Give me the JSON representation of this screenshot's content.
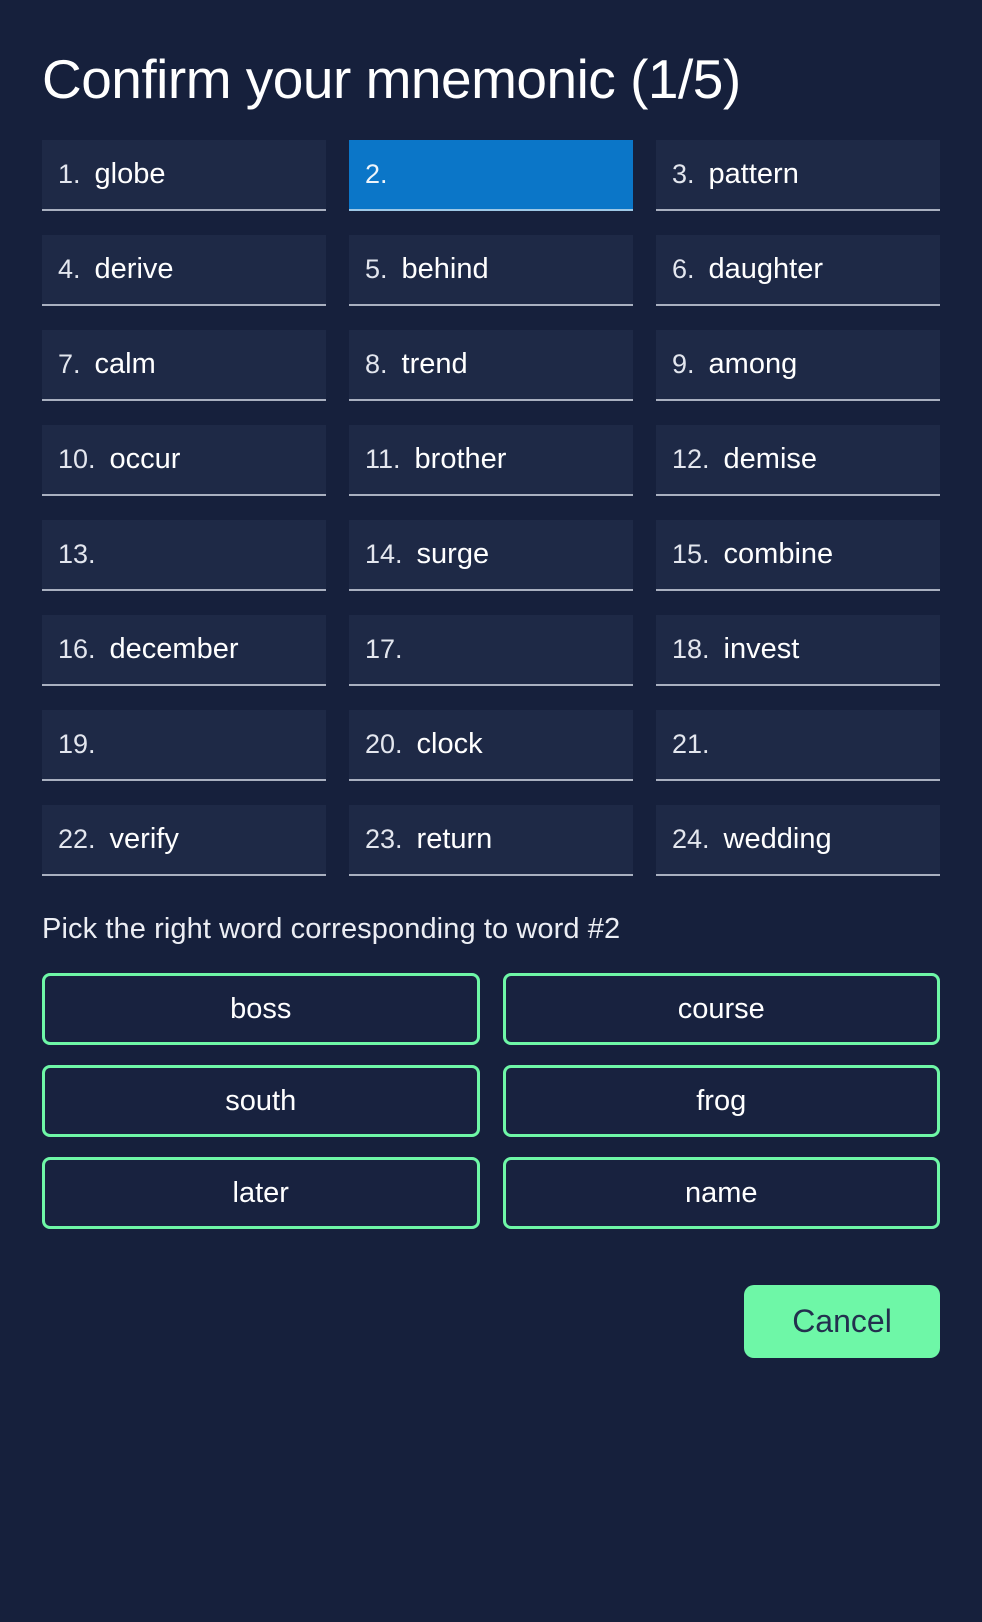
{
  "screen": {
    "title": "Confirm your mnemonic (1/5)",
    "background_color": "#16203c",
    "accent_green": "#6ef7a7",
    "accent_blue": "#0b76c8"
  },
  "mnemonic": {
    "words": [
      {
        "index": "1.",
        "word": "globe",
        "active": false
      },
      {
        "index": "2.",
        "word": "",
        "active": true
      },
      {
        "index": "3.",
        "word": "pattern",
        "active": false
      },
      {
        "index": "4.",
        "word": "derive",
        "active": false
      },
      {
        "index": "5.",
        "word": "behind",
        "active": false
      },
      {
        "index": "6.",
        "word": "daughter",
        "active": false
      },
      {
        "index": "7.",
        "word": "calm",
        "active": false
      },
      {
        "index": "8.",
        "word": "trend",
        "active": false
      },
      {
        "index": "9.",
        "word": "among",
        "active": false
      },
      {
        "index": "10.",
        "word": "occur",
        "active": false
      },
      {
        "index": "11.",
        "word": "brother",
        "active": false
      },
      {
        "index": "12.",
        "word": "demise",
        "active": false
      },
      {
        "index": "13.",
        "word": "",
        "active": false
      },
      {
        "index": "14.",
        "word": "surge",
        "active": false
      },
      {
        "index": "15.",
        "word": "combine",
        "active": false
      },
      {
        "index": "16.",
        "word": "december",
        "active": false
      },
      {
        "index": "17.",
        "word": "",
        "active": false
      },
      {
        "index": "18.",
        "word": "invest",
        "active": false
      },
      {
        "index": "19.",
        "word": "",
        "active": false
      },
      {
        "index": "20.",
        "word": "clock",
        "active": false
      },
      {
        "index": "21.",
        "word": "",
        "active": false
      },
      {
        "index": "22.",
        "word": "verify",
        "active": false
      },
      {
        "index": "23.",
        "word": "return",
        "active": false
      },
      {
        "index": "24.",
        "word": "wedding",
        "active": false
      }
    ]
  },
  "prompt": {
    "text": "Pick the right word corresponding to word #2"
  },
  "options": [
    {
      "label": "boss"
    },
    {
      "label": "course"
    },
    {
      "label": "south"
    },
    {
      "label": "frog"
    },
    {
      "label": "later"
    },
    {
      "label": "name"
    }
  ],
  "footer": {
    "cancel_label": "Cancel"
  }
}
